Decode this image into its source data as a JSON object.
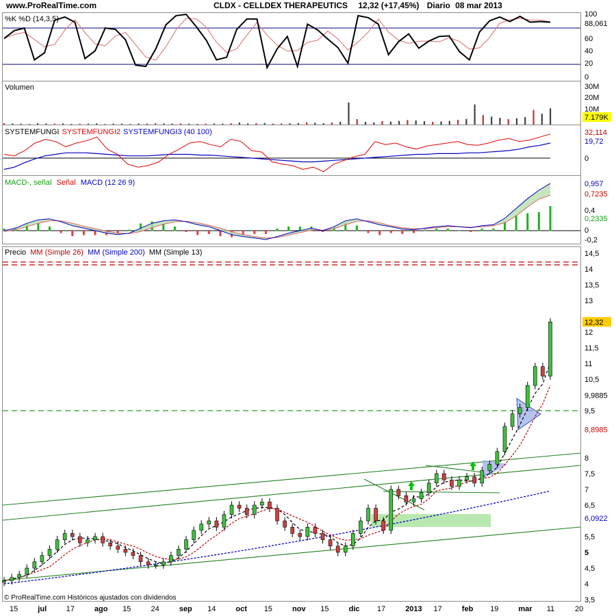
{
  "header": {
    "site": "www.ProRealTime.com",
    "title": "CLDX - CELLDEX THERAPEUTICS",
    "quote": "12,32 (+17,45%)",
    "period": "Diario",
    "date": "08 mar 2013"
  },
  "footer": {
    "copyright": "© ProRealTime.com Históricos ajustados con dividendos"
  },
  "x_axis": {
    "ticks": [
      {
        "label": "15",
        "bold": false
      },
      {
        "label": "jul",
        "bold": true
      },
      {
        "label": "17",
        "bold": false
      },
      {
        "label": "ago",
        "bold": true
      },
      {
        "label": "15",
        "bold": false
      },
      {
        "label": "24",
        "bold": false
      },
      {
        "label": "sep",
        "bold": true
      },
      {
        "label": "14",
        "bold": false
      },
      {
        "label": "oct",
        "bold": true
      },
      {
        "label": "15",
        "bold": false
      },
      {
        "label": "nov",
        "bold": true
      },
      {
        "label": "15",
        "bold": false
      },
      {
        "label": "dic",
        "bold": true
      },
      {
        "label": "17",
        "bold": false
      },
      {
        "label": "2013",
        "bold": true
      },
      {
        "label": "17",
        "bold": false
      },
      {
        "label": "feb",
        "bold": true
      },
      {
        "label": "19",
        "bold": false
      },
      {
        "label": "mar",
        "bold": true
      },
      {
        "label": "11",
        "bold": false
      },
      {
        "label": "20",
        "bold": false
      }
    ]
  },
  "chart_data": [
    {
      "type": "line",
      "panel": "stochastic",
      "title": "%K %D (14,3,5)",
      "series_names": [
        "%K",
        "%D"
      ],
      "y_ticks": [
        "100",
        "80",
        "60",
        "40",
        "20",
        "0"
      ],
      "levels": [
        80,
        20
      ],
      "current_value": "88,061",
      "series": [
        {
          "name": "%K",
          "values": [
            63,
            75,
            79,
            30,
            41,
            91,
            96,
            88,
            32,
            44,
            79,
            77,
            61,
            22,
            20,
            47,
            84,
            98,
            100,
            81,
            60,
            30,
            34,
            77,
            93,
            93,
            18,
            47,
            66,
            20,
            85,
            76,
            62,
            49,
            25,
            98,
            95,
            85,
            38,
            58,
            70,
            48,
            59,
            66,
            67,
            43,
            30,
            73,
            90,
            96,
            89,
            97,
            88,
            89,
            88
          ]
        }
      ]
    },
    {
      "type": "bar",
      "panel": "volume",
      "title": "Volumen",
      "y_ticks": [
        "30M",
        "20M",
        "10M"
      ],
      "current_value": "7.179K",
      "values_m": [
        0.6,
        0.5,
        0.4,
        0.3,
        0.6,
        0.5,
        0.4,
        0.5,
        0.3,
        0.4,
        0.4,
        0.5,
        0.3,
        0.4,
        0.4,
        0.3,
        0.5,
        0.4,
        0.6,
        0.5,
        0.4,
        0.5,
        0.4,
        0.3,
        0.4,
        0.5,
        0.4,
        0.6,
        0.9,
        0.5,
        0.6,
        0.7,
        0.4,
        0.5,
        0.6,
        0.7,
        1.0,
        0.8,
        0.6,
        0.9,
        1.2,
        9.8,
        2.4,
        1.2,
        1.0,
        1.5,
        1.3,
        1.6,
        2.0,
        1.8,
        1.5,
        1.2,
        1.4,
        1.6,
        2.1,
        2.5,
        8.9,
        4.2,
        3.5,
        3.0,
        2.4,
        2.8,
        3.3,
        6.5,
        4.8,
        7.2
      ]
    },
    {
      "type": "line",
      "panel": "systemfungi",
      "title": "SYSTEMFUNGI SYSTEMFUNGI2 SYSTEMFUNGI3 (40 100)",
      "y_ticks": [
        "0"
      ],
      "current_values": [
        "32,114",
        "19,72"
      ],
      "series": [
        {
          "name": "SYSTEMFUNGI2",
          "values": [
            5,
            3,
            10,
            20,
            25,
            22,
            15,
            20,
            23,
            28,
            12,
            5,
            -8,
            -12,
            -10,
            -5,
            5,
            12,
            20,
            22,
            18,
            15,
            25,
            22,
            10,
            8,
            -5,
            -8,
            -10,
            -15,
            -12,
            -18,
            -8,
            -3,
            2,
            5,
            22,
            18,
            20,
            15,
            12,
            16,
            18,
            20,
            22,
            18,
            17,
            20,
            24,
            26,
            22,
            24,
            28,
            32
          ]
        },
        {
          "name": "SYSTEMFUNGI3",
          "values": [
            -15,
            -12,
            -6,
            -1,
            3,
            5,
            7,
            7,
            7,
            6,
            5,
            4,
            3,
            3,
            3,
            4,
            5,
            5,
            5,
            4,
            4,
            3,
            2,
            1,
            0,
            -1,
            -2,
            -3,
            -4,
            -5,
            -5,
            -4,
            -3,
            -2,
            -1,
            0,
            1,
            2,
            3,
            4,
            5,
            5,
            6,
            6,
            6,
            7,
            7,
            8,
            9,
            10,
            12,
            15,
            17,
            20
          ]
        }
      ]
    },
    {
      "type": "area",
      "panel": "macd",
      "title": "MACD-, señal Señal MACD (12 26 9)",
      "title_parts": {
        "macd_minus": "MACD-, señal",
        "signal": "Señal",
        "macd": "MACD (12 26 9)"
      },
      "y_ticks": [
        "0,4",
        "0",
        "-0,2"
      ],
      "current_values": [
        "0,957",
        "0,7235",
        "0,2335"
      ],
      "series": [
        {
          "name": "MACD",
          "values": [
            0.0,
            0.05,
            0.15,
            0.22,
            0.24,
            0.18,
            0.1,
            0.05,
            0.0,
            -0.05,
            -0.08,
            -0.05,
            0.05,
            0.15,
            0.2,
            0.22,
            0.18,
            0.12,
            0.08,
            0.0,
            -0.08,
            -0.12,
            -0.15,
            -0.18,
            -0.12,
            -0.05,
            0.0,
            0.05,
            0.0,
            0.08,
            0.2,
            0.24,
            0.18,
            0.12,
            0.08,
            0.03,
            0.02,
            0.05,
            0.08,
            0.1,
            0.08,
            0.06,
            0.1,
            0.12,
            0.25,
            0.45,
            0.65,
            0.82,
            0.96
          ]
        },
        {
          "name": "Señal",
          "values": [
            -0.02,
            0.02,
            0.08,
            0.15,
            0.2,
            0.2,
            0.15,
            0.09,
            0.04,
            -0.01,
            -0.05,
            -0.06,
            -0.02,
            0.06,
            0.13,
            0.18,
            0.19,
            0.16,
            0.11,
            0.05,
            -0.02,
            -0.08,
            -0.12,
            -0.15,
            -0.14,
            -0.09,
            -0.04,
            0.01,
            0.01,
            0.04,
            0.12,
            0.19,
            0.2,
            0.16,
            0.1,
            0.06,
            0.04,
            0.04,
            0.06,
            0.08,
            0.08,
            0.07,
            0.08,
            0.1,
            0.16,
            0.3,
            0.48,
            0.64,
            0.72
          ]
        }
      ]
    },
    {
      "type": "candlestick",
      "panel": "price",
      "title": "Precio MM (Simple 26) MM (Simple 200) MM (Simple 13)",
      "title_parts": {
        "precio": "Precio",
        "mm26": "MM (Simple 26)",
        "mm200": "MM (Simple 200)",
        "mm13": "MM (Simple 13)"
      },
      "y_ticks": [
        "14,5",
        "14",
        "13,5",
        "13",
        "12",
        "11,5",
        "11",
        "10,5",
        "9,5",
        "8",
        "7,5",
        "7",
        "6,5",
        "5,5",
        "5",
        "4,5",
        "4",
        "3,5"
      ],
      "y_range": [
        3.5,
        14.5
      ],
      "horizontal_levels": [
        14.22,
        14.13,
        9.5
      ],
      "value_labels": [
        "12,32",
        "9,9885",
        "8,8985",
        "6,0922"
      ],
      "close": [
        4.1,
        4.2,
        4.3,
        4.5,
        4.7,
        4.9,
        5.1,
        5.4,
        5.6,
        5.5,
        5.3,
        5.4,
        5.5,
        5.3,
        5.2,
        5.1,
        5.0,
        4.9,
        4.7,
        4.6,
        4.6,
        4.7,
        4.9,
        5.1,
        5.4,
        5.7,
        5.9,
        6.0,
        5.8,
        6.2,
        6.5,
        6.4,
        6.2,
        6.5,
        6.6,
        6.4,
        6.0,
        5.8,
        5.6,
        5.5,
        5.8,
        5.6,
        5.4,
        5.2,
        5.0,
        5.2,
        5.6,
        6.0,
        6.4,
        6.0,
        5.7,
        7.0,
        6.8,
        6.6,
        6.7,
        6.9,
        7.2,
        7.5,
        7.3,
        7.1,
        7.3,
        7.4,
        7.2,
        7.6,
        7.8,
        8.2,
        9.0,
        9.4,
        9.6,
        10.3,
        10.9,
        10.6,
        12.32
      ]
    }
  ]
}
